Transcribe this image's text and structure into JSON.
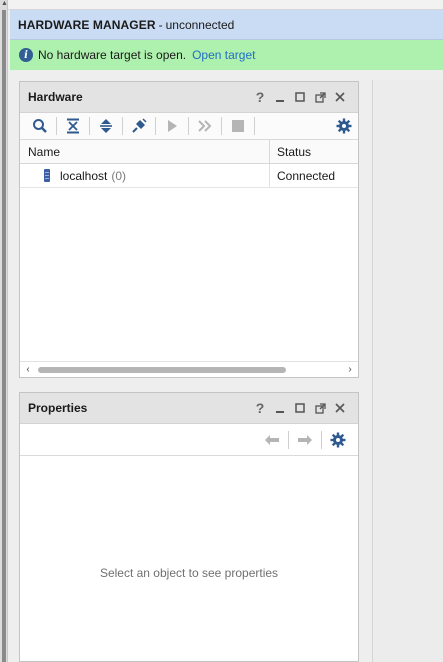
{
  "manager": {
    "title": "HARDWARE MANAGER",
    "separator": "-",
    "state": "unconnected"
  },
  "banner": {
    "icon": "info-icon",
    "message": "No hardware target is open.",
    "link": "Open target"
  },
  "hardware_panel": {
    "title": "Hardware",
    "window_controls": {
      "help": "?"
    },
    "toolbar_icons": [
      "search-icon",
      "collapse-all-icon",
      "expand-all-icon",
      "auto-connect-icon",
      "run-icon",
      "run-all-icon",
      "stop-icon",
      "settings-gear-icon"
    ],
    "columns": [
      "Name",
      "Status"
    ],
    "rows": [
      {
        "icon": "server-icon",
        "name": "localhost",
        "count": "(0)",
        "status": "Connected"
      }
    ]
  },
  "properties_panel": {
    "title": "Properties",
    "window_controls": {
      "help": "?"
    },
    "toolbar_icons": [
      "back-arrow-icon",
      "forward-arrow-icon",
      "settings-gear-icon"
    ],
    "empty_message": "Select an object to see properties"
  },
  "colors": {
    "header_bg": "#c9dcf4",
    "banner_bg": "#aef0ad",
    "link": "#1f6fc5",
    "icon_blue": "#2f5f94"
  }
}
